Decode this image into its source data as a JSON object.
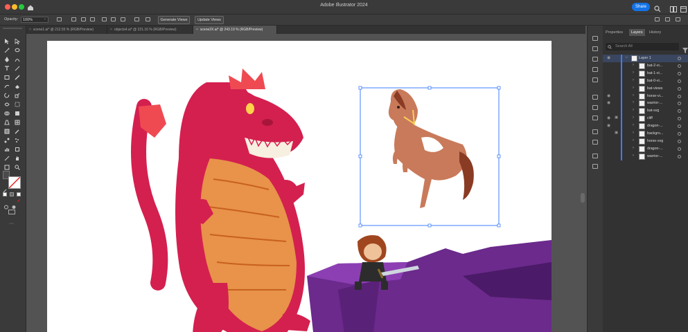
{
  "window": {
    "title": "Adobe Illustrator 2024",
    "share_label": "Share"
  },
  "controlbar": {
    "opacity_label": "Opacity:",
    "opacity_value": "100%",
    "generate_views": "Generate Views",
    "update_views": "Update Views"
  },
  "tabs": [
    {
      "label": "scene1.ai* @ 212.55 % (RGB/Preview)",
      "active": false
    },
    {
      "label": "objects4.ai* @ 221.16 % (RGB/Preview)",
      "active": false
    },
    {
      "label": "scene2X.ai* @ 243.19 % (RGB/Preview)",
      "active": true
    }
  ],
  "panel": {
    "tabs": [
      "Properties",
      "Layers",
      "History"
    ],
    "active_tab": "Layers",
    "search_placeholder": "Search All",
    "layers": [
      {
        "name": "Layer 1",
        "eye": true,
        "lock": false,
        "top": true
      },
      {
        "name": "bat-2-vi...",
        "eye": false,
        "lock": false
      },
      {
        "name": "bat-1-vi...",
        "eye": false,
        "lock": false
      },
      {
        "name": "bat-0-vi...",
        "eye": false,
        "lock": false
      },
      {
        "name": "bat-views",
        "eye": false,
        "lock": false
      },
      {
        "name": "horse-vi...",
        "eye": true,
        "lock": false
      },
      {
        "name": "warrior-...",
        "eye": true,
        "lock": false
      },
      {
        "name": "bat-svg",
        "eye": false,
        "lock": false
      },
      {
        "name": "cliff",
        "eye": true,
        "lock": true
      },
      {
        "name": "dragon-...",
        "eye": true,
        "lock": false
      },
      {
        "name": "backgro...",
        "eye": false,
        "lock": true
      },
      {
        "name": "horse-svg",
        "eye": false,
        "lock": false
      },
      {
        "name": "dragon-...",
        "eye": false,
        "lock": false
      },
      {
        "name": "warrior-...",
        "eye": false,
        "lock": false
      }
    ]
  },
  "colors": {
    "accent": "#1473e6",
    "selection": "#3c7dff",
    "dragon": "#d4204f",
    "belly": "#e8924a",
    "cliff": "#6b2a8c",
    "horse": "#c97a5a"
  },
  "icons": [
    "home-icon",
    "search-icon",
    "arrange-icon",
    "filter-icon",
    "eye-icon",
    "lock-icon"
  ]
}
